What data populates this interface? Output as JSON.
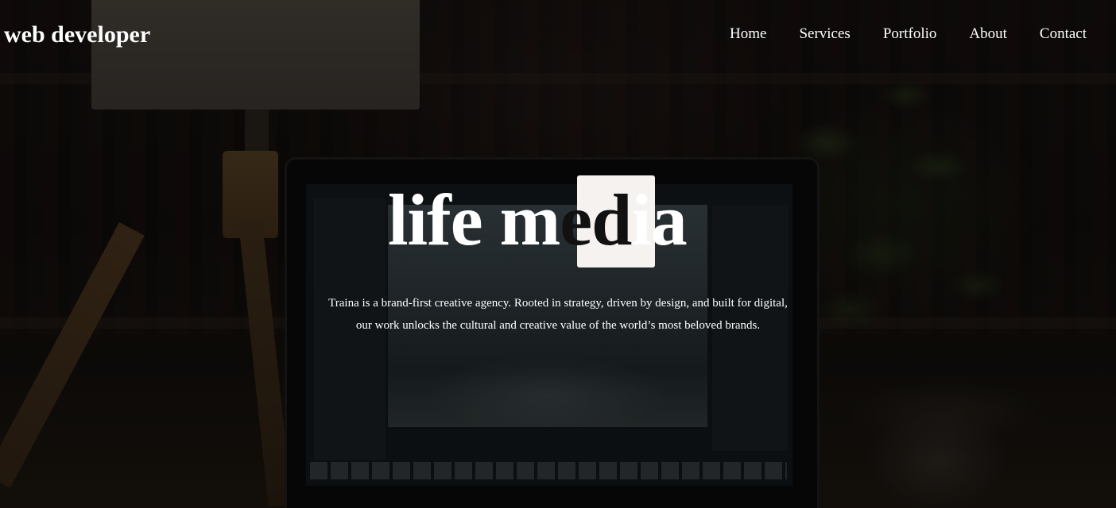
{
  "header": {
    "brand": "web developer",
    "nav": [
      {
        "label": "Home"
      },
      {
        "label": "Services"
      },
      {
        "label": "Portfolio"
      },
      {
        "label": "About"
      },
      {
        "label": "Contact"
      }
    ]
  },
  "hero": {
    "logo": {
      "part1": "life m",
      "highlight": "ed",
      "part2": "ia"
    },
    "tagline_line1": "Traina is a brand-first creative agency. Rooted in strategy, driven by design, and built for digital,",
    "tagline_line2": "our work unlocks the cultural and creative value of the world’s most beloved brands."
  },
  "colors": {
    "text": "#ffffff",
    "logo_box": "#f6f2ef",
    "logo_highlight_text": "#111111",
    "overlay": "rgba(0,0,0,0.55)"
  }
}
